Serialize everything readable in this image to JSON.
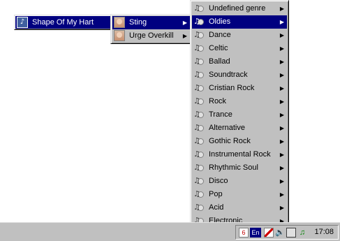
{
  "song_menu": {
    "items": [
      {
        "label": "Shape Of My Hart",
        "icon": "music-file-icon"
      }
    ]
  },
  "artist_menu": {
    "items": [
      {
        "label": "Sting",
        "icon": "artist-avatar-icon",
        "selected": true
      },
      {
        "label": "Urge Overkill",
        "icon": "artist-avatar-icon",
        "selected": false
      }
    ]
  },
  "genre_menu": {
    "items": [
      {
        "label": "Undefined genre"
      },
      {
        "label": "Oldies",
        "selected": true
      },
      {
        "label": "Dance"
      },
      {
        "label": "Celtic"
      },
      {
        "label": "Ballad"
      },
      {
        "label": "Soundtrack"
      },
      {
        "label": "Cristian Rock"
      },
      {
        "label": "Rock"
      },
      {
        "label": "Trance"
      },
      {
        "label": "Alternative"
      },
      {
        "label": "Gothic Rock"
      },
      {
        "label": "Instrumental Rock"
      },
      {
        "label": "Rhythmic Soul"
      },
      {
        "label": "Disco"
      },
      {
        "label": "Pop"
      },
      {
        "label": "Acid"
      },
      {
        "label": "Electronic"
      }
    ]
  },
  "taskbar": {
    "tray": {
      "language": "En",
      "clock": "17:08",
      "icons": [
        "app-tray-icon",
        "language-indicator",
        "blocked-icon",
        "volume-icon",
        "printer-icon",
        "music-tray-icon"
      ]
    }
  },
  "colors": {
    "menu_bg": "#c0c0c0",
    "selection": "#000080",
    "selection_text": "#ffffff"
  }
}
